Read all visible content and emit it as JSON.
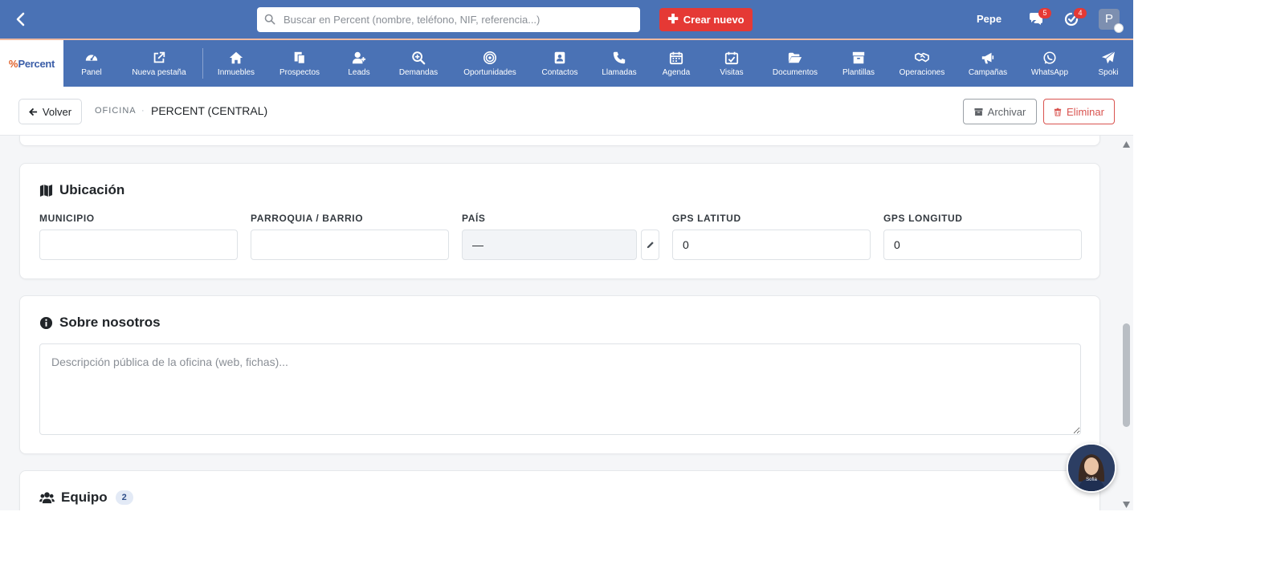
{
  "topbar": {
    "search_placeholder": "Buscar en Percent (nombre, teléfono, NIF, referencia...)",
    "create_label": "Crear nuevo",
    "username": "Pepe",
    "messages_badge": "5",
    "notifications_badge": "4",
    "avatar_initial": "P"
  },
  "logo": {
    "mark": "%",
    "text": "Percent"
  },
  "nav": {
    "items": [
      {
        "label": "Panel",
        "icon": "gauge-icon"
      },
      {
        "label": "Nueva pestaña",
        "icon": "external-link-icon"
      },
      {
        "label": "Inmuebles",
        "icon": "home-icon"
      },
      {
        "label": "Prospectos",
        "icon": "documents-icon"
      },
      {
        "label": "Leads",
        "icon": "user-plus-icon"
      },
      {
        "label": "Demandas",
        "icon": "search-plus-icon"
      },
      {
        "label": "Oportunidades",
        "icon": "target-icon"
      },
      {
        "label": "Contactos",
        "icon": "contact-card-icon"
      },
      {
        "label": "Llamadas",
        "icon": "phone-icon"
      },
      {
        "label": "Agenda",
        "icon": "calendar-icon"
      },
      {
        "label": "Visitas",
        "icon": "calendar-check-icon"
      },
      {
        "label": "Documentos",
        "icon": "folder-open-icon"
      },
      {
        "label": "Plantillas",
        "icon": "archive-box-icon"
      },
      {
        "label": "Operaciones",
        "icon": "handshake-icon"
      },
      {
        "label": "Campañas",
        "icon": "megaphone-icon"
      },
      {
        "label": "WhatsApp",
        "icon": "whatsapp-icon"
      },
      {
        "label": "Spoki",
        "icon": "paper-plane-icon"
      }
    ]
  },
  "subheader": {
    "back_label": "Volver",
    "breadcrumb_section": "OFICINA",
    "breadcrumb_separator": "·",
    "breadcrumb_current": "PERCENT (CENTRAL)",
    "archive_label": "Archivar",
    "delete_label": "Eliminar"
  },
  "ubicacion": {
    "title": "Ubicación",
    "municipio_label": "MUNICIPIO",
    "municipio_value": "",
    "parroquia_label": "PARROQUIA / BARRIO",
    "parroquia_value": "",
    "pais_label": "PAÍS",
    "pais_value": "—",
    "gps_lat_label": "GPS LATITUD",
    "gps_lat_value": "0",
    "gps_lng_label": "GPS LONGITUD",
    "gps_lng_value": "0"
  },
  "sobre": {
    "title": "Sobre nosotros",
    "description_placeholder": "Descripción pública de la oficina (web, fichas)..."
  },
  "equipo": {
    "title": "Equipo",
    "count": "2"
  },
  "assistant": {
    "label": "Sofia"
  }
}
